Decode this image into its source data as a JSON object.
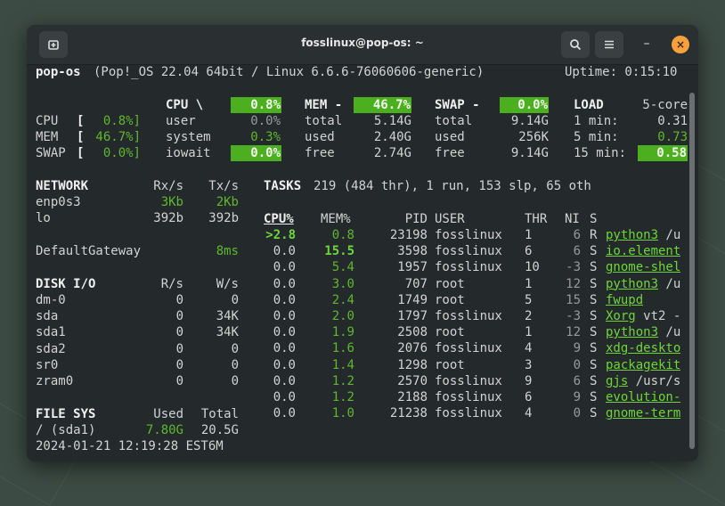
{
  "window": {
    "title": "fosslinux@pop-os: ~",
    "new_tab_icon": "new-tab-icon",
    "search_icon": "search-icon",
    "menu_icon": "hamburger-menu-icon",
    "minimize_label": "–",
    "close_label": "×"
  },
  "header": {
    "host": "pop-os",
    "system": "(Pop!_OS 22.04 64bit / Linux 6.6.6-76060606-generic)",
    "uptime": "Uptime: 0:15:10"
  },
  "quicklook": {
    "cpu_label": "CPU",
    "cpu_bracket_open": "[",
    "cpu_value": "0.8%]",
    "mem_label": "MEM",
    "mem_bracket_open": "[",
    "mem_value": "46.7%]",
    "swap_label": "SWAP",
    "swap_bracket_open": "[",
    "swap_value": "0.0%]"
  },
  "cpu": {
    "title": "CPU \\",
    "total": "0.8%",
    "rows": [
      {
        "label": "user",
        "value": "0.0%"
      },
      {
        "label": "system",
        "value": "0.3%"
      },
      {
        "label": "iowait",
        "value": "0.0%"
      }
    ]
  },
  "mem": {
    "title": "MEM -",
    "total": "46.7%",
    "rows": [
      {
        "label": "total",
        "value": "5.14G"
      },
      {
        "label": "used",
        "value": "2.40G"
      },
      {
        "label": "free",
        "value": "2.74G"
      }
    ]
  },
  "swap": {
    "title": "SWAP -",
    "total": "0.0%",
    "rows": [
      {
        "label": "total",
        "value": "9.14G"
      },
      {
        "label": "used",
        "value": "256K"
      },
      {
        "label": "free",
        "value": "9.14G"
      }
    ]
  },
  "load": {
    "title": "LOAD",
    "cores": "5-core",
    "rows": [
      {
        "label": "1 min:",
        "value": "0.31"
      },
      {
        "label": "5 min:",
        "value": "0.73"
      },
      {
        "label": "15 min:",
        "value": "0.58"
      }
    ]
  },
  "network": {
    "title": "NETWORK",
    "rx_header": "Rx/s",
    "tx_header": "Tx/s",
    "rows": [
      {
        "name": "enp0s3",
        "rx": "3Kb",
        "tx": "2Kb"
      },
      {
        "name": "lo",
        "rx": "392b",
        "tx": "392b"
      }
    ],
    "gateway_label": "DefaultGateway",
    "gateway_value": "8ms"
  },
  "disk": {
    "title": "DISK I/O",
    "r_header": "R/s",
    "w_header": "W/s",
    "rows": [
      {
        "name": "dm-0",
        "r": "0",
        "w": "0"
      },
      {
        "name": "sda",
        "r": "0",
        "w": "34K"
      },
      {
        "name": "sda1",
        "r": "0",
        "w": "34K"
      },
      {
        "name": "sda2",
        "r": "0",
        "w": "0"
      },
      {
        "name": "sr0",
        "r": "0",
        "w": "0"
      },
      {
        "name": "zram0",
        "r": "0",
        "w": "0"
      }
    ]
  },
  "fs": {
    "title": "FILE SYS",
    "used_header": "Used",
    "total_header": "Total",
    "rows": [
      {
        "name": "/ (sda1)",
        "used": "7.80G",
        "total": "20.5G"
      }
    ]
  },
  "datetime": "2024-01-21 12:19:28 EST6M",
  "tasks": {
    "title": "TASKS",
    "summary": "219 (484 thr), 1 run, 153 slp, 65 oth"
  },
  "processes": {
    "headers": {
      "cpu": "CPU%",
      "mem": "MEM%",
      "pid": "PID",
      "user": "USER",
      "thr": "THR",
      "ni": "NI",
      "s": "S"
    },
    "rows": [
      {
        "cpu": ">2.8",
        "mem": "0.8",
        "pid": "23198",
        "user": "fosslinux",
        "thr": "1",
        "ni": "6",
        "s": "R",
        "cmd": "python3",
        "args": " /u"
      },
      {
        "cpu": "0.0",
        "mem": "15.5",
        "pid": "3598",
        "user": "fosslinux",
        "thr": "6",
        "ni": "6",
        "s": "S",
        "cmd": "io.element",
        "args": ""
      },
      {
        "cpu": "0.0",
        "mem": "5.4",
        "pid": "1957",
        "user": "fosslinux",
        "thr": "10",
        "ni": "-3",
        "s": "S",
        "cmd": "gnome-shel",
        "args": ""
      },
      {
        "cpu": "0.0",
        "mem": "3.0",
        "pid": "707",
        "user": "root",
        "thr": "1",
        "ni": "12",
        "s": "S",
        "cmd": "python3",
        "args": " /u"
      },
      {
        "cpu": "0.0",
        "mem": "2.4",
        "pid": "1749",
        "user": "root",
        "thr": "5",
        "ni": "15",
        "s": "S",
        "cmd": "fwupd",
        "args": ""
      },
      {
        "cpu": "0.0",
        "mem": "2.0",
        "pid": "1797",
        "user": "fosslinux",
        "thr": "2",
        "ni": "-3",
        "s": "S",
        "cmd": "Xorg",
        "args": " vt2 -"
      },
      {
        "cpu": "0.0",
        "mem": "1.9",
        "pid": "2508",
        "user": "root",
        "thr": "1",
        "ni": "12",
        "s": "S",
        "cmd": "python3",
        "args": " /u"
      },
      {
        "cpu": "0.0",
        "mem": "1.6",
        "pid": "2076",
        "user": "fosslinux",
        "thr": "4",
        "ni": "9",
        "s": "S",
        "cmd": "xdg-deskto",
        "args": ""
      },
      {
        "cpu": "0.0",
        "mem": "1.4",
        "pid": "1298",
        "user": "root",
        "thr": "3",
        "ni": "0",
        "s": "S",
        "cmd": "packagekit",
        "args": ""
      },
      {
        "cpu": "0.0",
        "mem": "1.2",
        "pid": "2570",
        "user": "fosslinux",
        "thr": "9",
        "ni": "6",
        "s": "S",
        "cmd": "gjs",
        "args": " /usr/s"
      },
      {
        "cpu": "0.0",
        "mem": "1.2",
        "pid": "2188",
        "user": "fosslinux",
        "thr": "6",
        "ni": "9",
        "s": "S",
        "cmd": "evolution-",
        "args": ""
      },
      {
        "cpu": "0.0",
        "mem": "1.0",
        "pid": "21238",
        "user": "fosslinux",
        "thr": "4",
        "ni": "0",
        "s": "S",
        "cmd": "gnome-term",
        "args": ""
      }
    ]
  },
  "colors": {
    "accent": "#4caf1f",
    "close_button": "#f6a13c",
    "background": "#24292b"
  }
}
